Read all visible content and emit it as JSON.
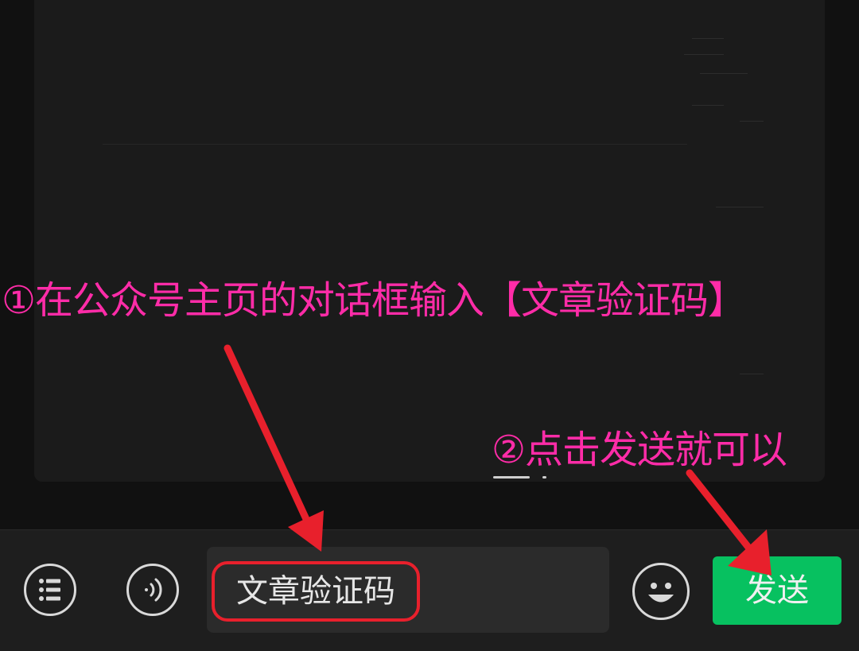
{
  "annotations": {
    "step1": "①在公众号主页的对话框输入【文章验证码】",
    "step2": "②点击发送就可以"
  },
  "input": {
    "value": "文章验证码"
  },
  "buttons": {
    "send_label": "发送",
    "menu_icon": "list-icon",
    "voice_icon": "voice-icon",
    "emoji_icon": "emoji-icon"
  },
  "colors": {
    "send_button": "#07c160",
    "annotation_text": "#ff2ca8",
    "highlight": "#e8202c"
  }
}
